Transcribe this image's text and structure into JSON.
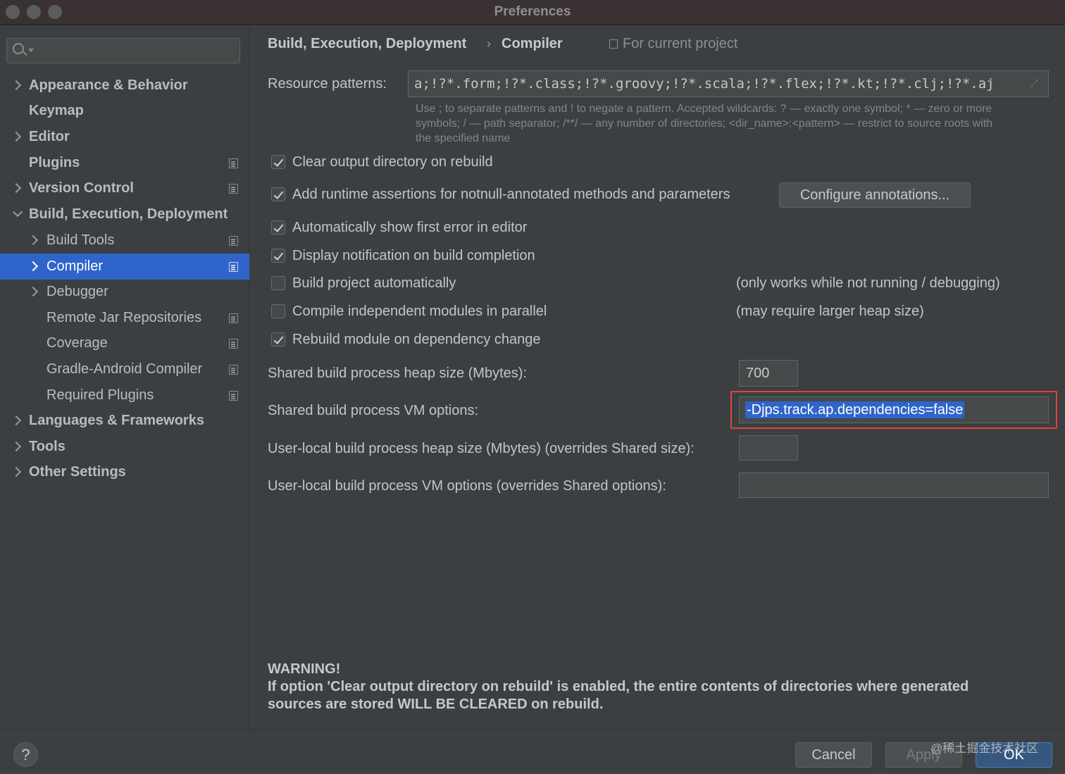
{
  "window": {
    "title": "Preferences"
  },
  "sidebar": {
    "search_placeholder": "",
    "items": [
      {
        "label": "Appearance & Behavior"
      },
      {
        "label": "Keymap"
      },
      {
        "label": "Editor"
      },
      {
        "label": "Plugins"
      },
      {
        "label": "Version Control"
      },
      {
        "label": "Build, Execution, Deployment"
      },
      {
        "label": "Build Tools"
      },
      {
        "label": "Compiler"
      },
      {
        "label": "Debugger"
      },
      {
        "label": "Remote Jar Repositories"
      },
      {
        "label": "Coverage"
      },
      {
        "label": "Gradle-Android Compiler"
      },
      {
        "label": "Required Plugins"
      },
      {
        "label": "Languages & Frameworks"
      },
      {
        "label": "Tools"
      },
      {
        "label": "Other Settings"
      }
    ]
  },
  "header": {
    "breadcrumb_parent": "Build, Execution, Deployment",
    "breadcrumb_sep": "›",
    "breadcrumb_current": "Compiler",
    "scope": "For current project"
  },
  "resource": {
    "label": "Resource patterns:",
    "value": "a;!?*.form;!?*.class;!?*.groovy;!?*.scala;!?*.flex;!?*.kt;!?*.clj;!?*.aj",
    "hint_line1": "Use ; to separate patterns and ! to negate a pattern. Accepted wildcards: ? — exactly one symbol; * — zero or more",
    "hint_line2": "symbols; / — path separator; /**/ — any number of directories; <dir_name>:<pattern> — restrict to source roots with",
    "hint_line3": "the specified name"
  },
  "options": {
    "clear_output": {
      "label": "Clear output directory on rebuild",
      "checked": true
    },
    "runtime_assertions": {
      "label": "Add runtime assertions for notnull-annotated methods and parameters",
      "checked": true
    },
    "configure_annotations": "Configure annotations...",
    "show_first_error": {
      "label": "Automatically show first error in editor",
      "checked": true
    },
    "notification": {
      "label": "Display notification on build completion",
      "checked": true
    },
    "build_auto": {
      "label": "Build project automatically",
      "checked": false,
      "note": "(only works while not running / debugging)"
    },
    "compile_parallel": {
      "label": "Compile independent modules in parallel",
      "checked": false,
      "note": "(may require larger heap size)"
    },
    "rebuild_module": {
      "label": "Rebuild module on dependency change",
      "checked": true
    }
  },
  "process": {
    "shared_heap_label": "Shared build process heap size (Mbytes):",
    "shared_heap_value": "700",
    "shared_vm_label": "Shared build process VM options:",
    "shared_vm_value": "-Djps.track.ap.dependencies=false",
    "user_heap_label": "User-local build process heap size (Mbytes) (overrides Shared size):",
    "user_heap_value": "",
    "user_vm_label": "User-local build process VM options (overrides Shared options):",
    "user_vm_value": ""
  },
  "warning": {
    "title": "WARNING!",
    "line1": "If option 'Clear output directory on rebuild' is enabled, the entire contents of directories where generated",
    "line2": "sources are stored WILL BE CLEARED on rebuild."
  },
  "footer": {
    "help": "?",
    "cancel": "Cancel",
    "apply": "Apply",
    "ok": "OK",
    "watermark": "@稀土掘金技术社区"
  },
  "colors": {
    "selection": "#2f65ca",
    "highlight_border": "#e0443a",
    "background": "#3c3f41"
  }
}
